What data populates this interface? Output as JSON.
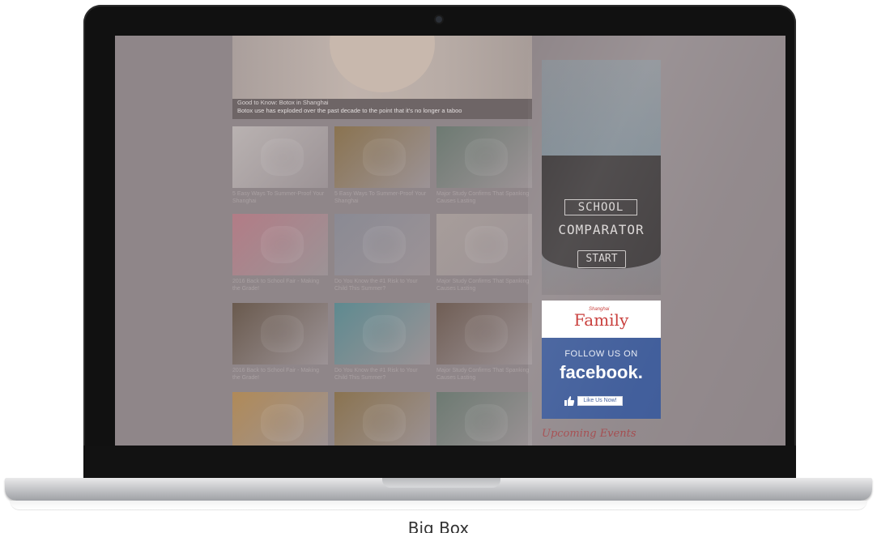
{
  "hero": {
    "title": "Good to Know: Botox in Shanghai",
    "subtitle": "Botox use has exploded over the past decade to the point that it's no longer a taboo"
  },
  "articles": [
    {
      "caption": "5 Easy Ways To Summer-Proof Your Shanghai",
      "color": "#b9b2b1"
    },
    {
      "caption": "5 Easy Ways To Summer-Proof Your Shanghai",
      "color": "#8a7350"
    },
    {
      "caption": "Major Study Confirms That Spanking Causes Lasting",
      "color": "#6d7a72"
    },
    {
      "caption": "2016 Back to School Fair - Making the Grade!",
      "color": "#b27c86"
    },
    {
      "caption": "Do You Know the #1 Risk to Your Child This Summer?",
      "color": "#8a8a94"
    },
    {
      "caption": "Major Study Confirms That Spanking Causes Lasting",
      "color": "#a79d9a"
    },
    {
      "caption": "2016 Back to School Fair - Making the Grade!",
      "color": "#6a5a4e"
    },
    {
      "caption": "Do You Know the #1 Risk to Your Child This Summer?",
      "color": "#5e8a90"
    },
    {
      "caption": "Major Study Confirms That Spanking Causes Lasting",
      "color": "#705e55"
    },
    {
      "caption": "",
      "color": "#b08a58"
    },
    {
      "caption": "",
      "color": "#8a7350"
    },
    {
      "caption": "",
      "color": "#6d7a72"
    }
  ],
  "sidebar": {
    "school_word": "SCHOOL",
    "comparator_word": "COMPARATOR",
    "start_label": "START",
    "brand_small": "Shanghai",
    "brand": "Family",
    "follow_text": "FOLLOW US ON",
    "facebook_text": "facebook.",
    "like_label": "Like Us Now!",
    "upcoming": "Upcoming Events"
  },
  "caption": "Big Box",
  "colors": {
    "facebook_blue": "#3b5998",
    "brand_red": "#c5322f",
    "screen_dim": "#8f8689"
  }
}
